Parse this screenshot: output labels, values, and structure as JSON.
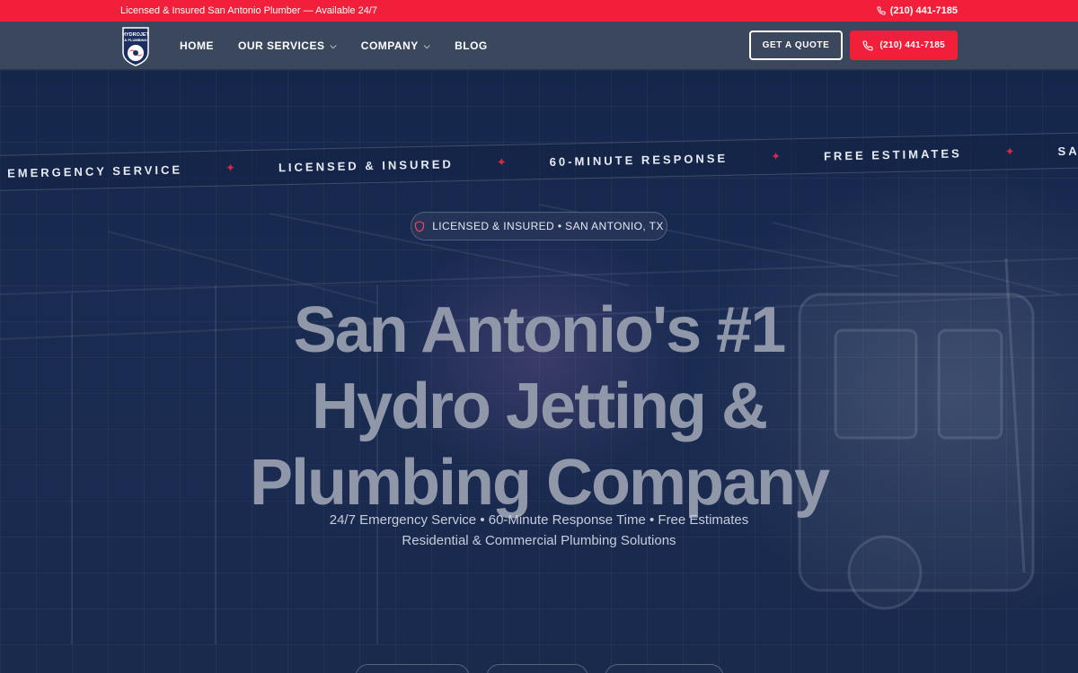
{
  "topbar": {
    "tagline": "Licensed & Insured San Antonio Plumber — Available 24/7",
    "phone": "(210) 441-7185"
  },
  "header": {
    "logo_text": "HYDROJET & PLUMBING",
    "nav": [
      {
        "label": "HOME"
      },
      {
        "label": "OUR SERVICES"
      },
      {
        "label": "COMPANY"
      },
      {
        "label": "BLOG"
      }
    ],
    "quote_label": "GET A QUOTE",
    "call_label": "(210) 441-7185"
  },
  "ticker": {
    "items": [
      "EMERGENCY SERVICE",
      "LICENSED & INSURED",
      "60-MINUTE RESPONSE",
      "FREE ESTIMATES",
      "SAN ANTONIO"
    ]
  },
  "hero": {
    "badge": "LICENSED & INSURED • SAN ANTONIO, TX",
    "headline_line1": "San Antonio's #1",
    "headline_line2": "Hydro Jetting &",
    "headline_line3": "Plumbing Company",
    "sub_line1": "24/7 Emergency Service • 60-Minute Response Time • Free Estimates",
    "sub_line2": "Residential & Commercial Plumbing Solutions"
  },
  "colors": {
    "accent": "#f21f3b",
    "header_bg": "#3a475d",
    "hero_bg": "#15264b"
  }
}
